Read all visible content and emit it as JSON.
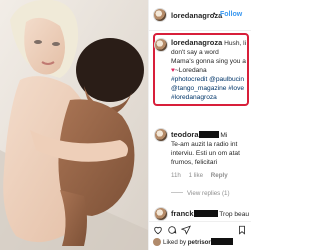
{
  "post": {
    "photo_alt": "",
    "header": {
      "username": "loredanagroza",
      "separator": "•",
      "follow_label": "Follow"
    },
    "caption": {
      "username": "loredanagroza",
      "lines": [
        "Hush, li",
        "don't say a word",
        "Mama's gonna sing you a",
        "~Loredana"
      ],
      "hashtag_lines": [
        "#photocredit @paulbucin",
        "@tango_magazine #love",
        "#loredanagroza"
      ]
    },
    "comments": [
      {
        "username": "teodora",
        "lines": [
          "Mi",
          "Te-am auzit la radio int",
          "interviu. Esti un om atat",
          "frumos, felicitari"
        ],
        "age": "11h",
        "likes": "1 like",
        "reply_label": "Reply",
        "view_replies": "View replies (1)"
      },
      {
        "username": "franck",
        "text": "Trop beau"
      }
    ],
    "liked_by": {
      "prefix": "Liked by",
      "user": "petrisor"
    }
  },
  "icons": [
    "more-options-icon",
    "heart-icon",
    "comment-icon",
    "share-icon",
    "bookmark-icon",
    "redaction-bar"
  ],
  "colors": {
    "highlight_border": "#d81f3a",
    "link": "#003569",
    "follow": "#3897f0",
    "meta_text": "#8e8e8e"
  }
}
